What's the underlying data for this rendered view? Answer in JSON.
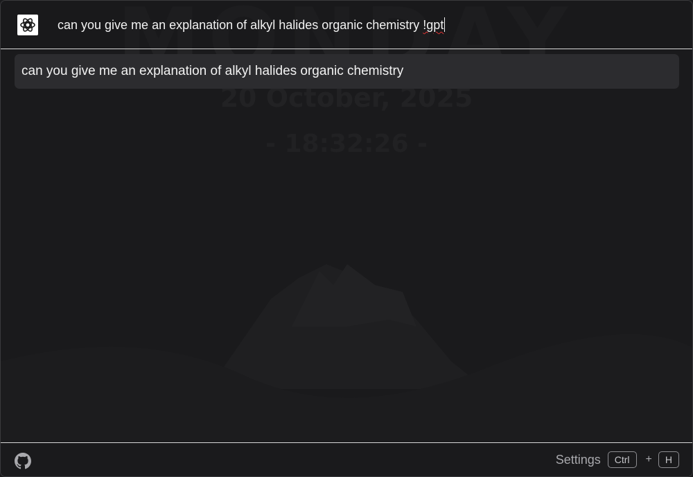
{
  "wallpaper": {
    "day": "MONDAY",
    "date": "20 October, 2025",
    "time": "- 18:32:26 -"
  },
  "header": {
    "logo_icon": "chatgpt-logo-icon",
    "query_text": "can you give me an explanation of alkyl halides organic chemistry ",
    "query_command": "!gpt"
  },
  "results": [
    {
      "label": "can you give me an explanation of alkyl halides organic chemistry"
    }
  ],
  "footer": {
    "github_icon": "github-icon",
    "settings_label": "Settings",
    "shortcut_key1": "Ctrl",
    "shortcut_plus": "+",
    "shortcut_key2": "H"
  },
  "colors": {
    "background": "#1a1a1c",
    "result_bg": "#2c2c2f",
    "divider": "#d9d9d9",
    "text": "#f2f2f2",
    "muted": "#a9a9ad"
  }
}
